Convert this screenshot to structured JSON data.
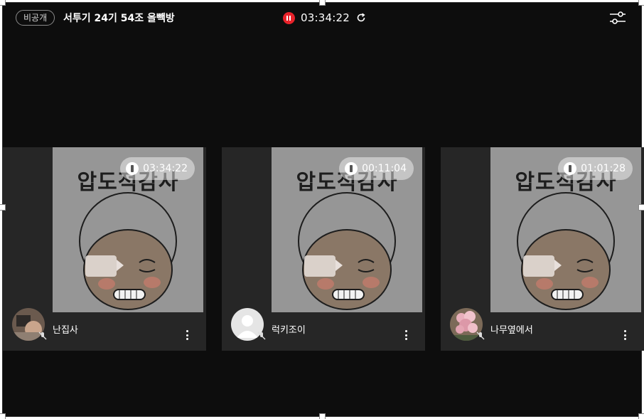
{
  "header": {
    "visibility_badge": "비공개",
    "room_title": "서투기 24기 54조 올빽방",
    "timer": "03:34:22",
    "icons": [
      "pause-icon",
      "refresh-icon",
      "settings-sliders-icon"
    ],
    "record_color": "#e8222a"
  },
  "participants": [
    {
      "nickname": "난집사",
      "study_time": "03:34:22",
      "thumbnail_title": "압도적감사",
      "avatar": "photo"
    },
    {
      "nickname": "럭키조이",
      "study_time": "00:11:04",
      "thumbnail_title": "압도적감사",
      "avatar": "default-user"
    },
    {
      "nickname": "나무옆에서",
      "study_time": "01:01:28",
      "thumbnail_title": "압도적감사",
      "avatar": "flower"
    }
  ]
}
